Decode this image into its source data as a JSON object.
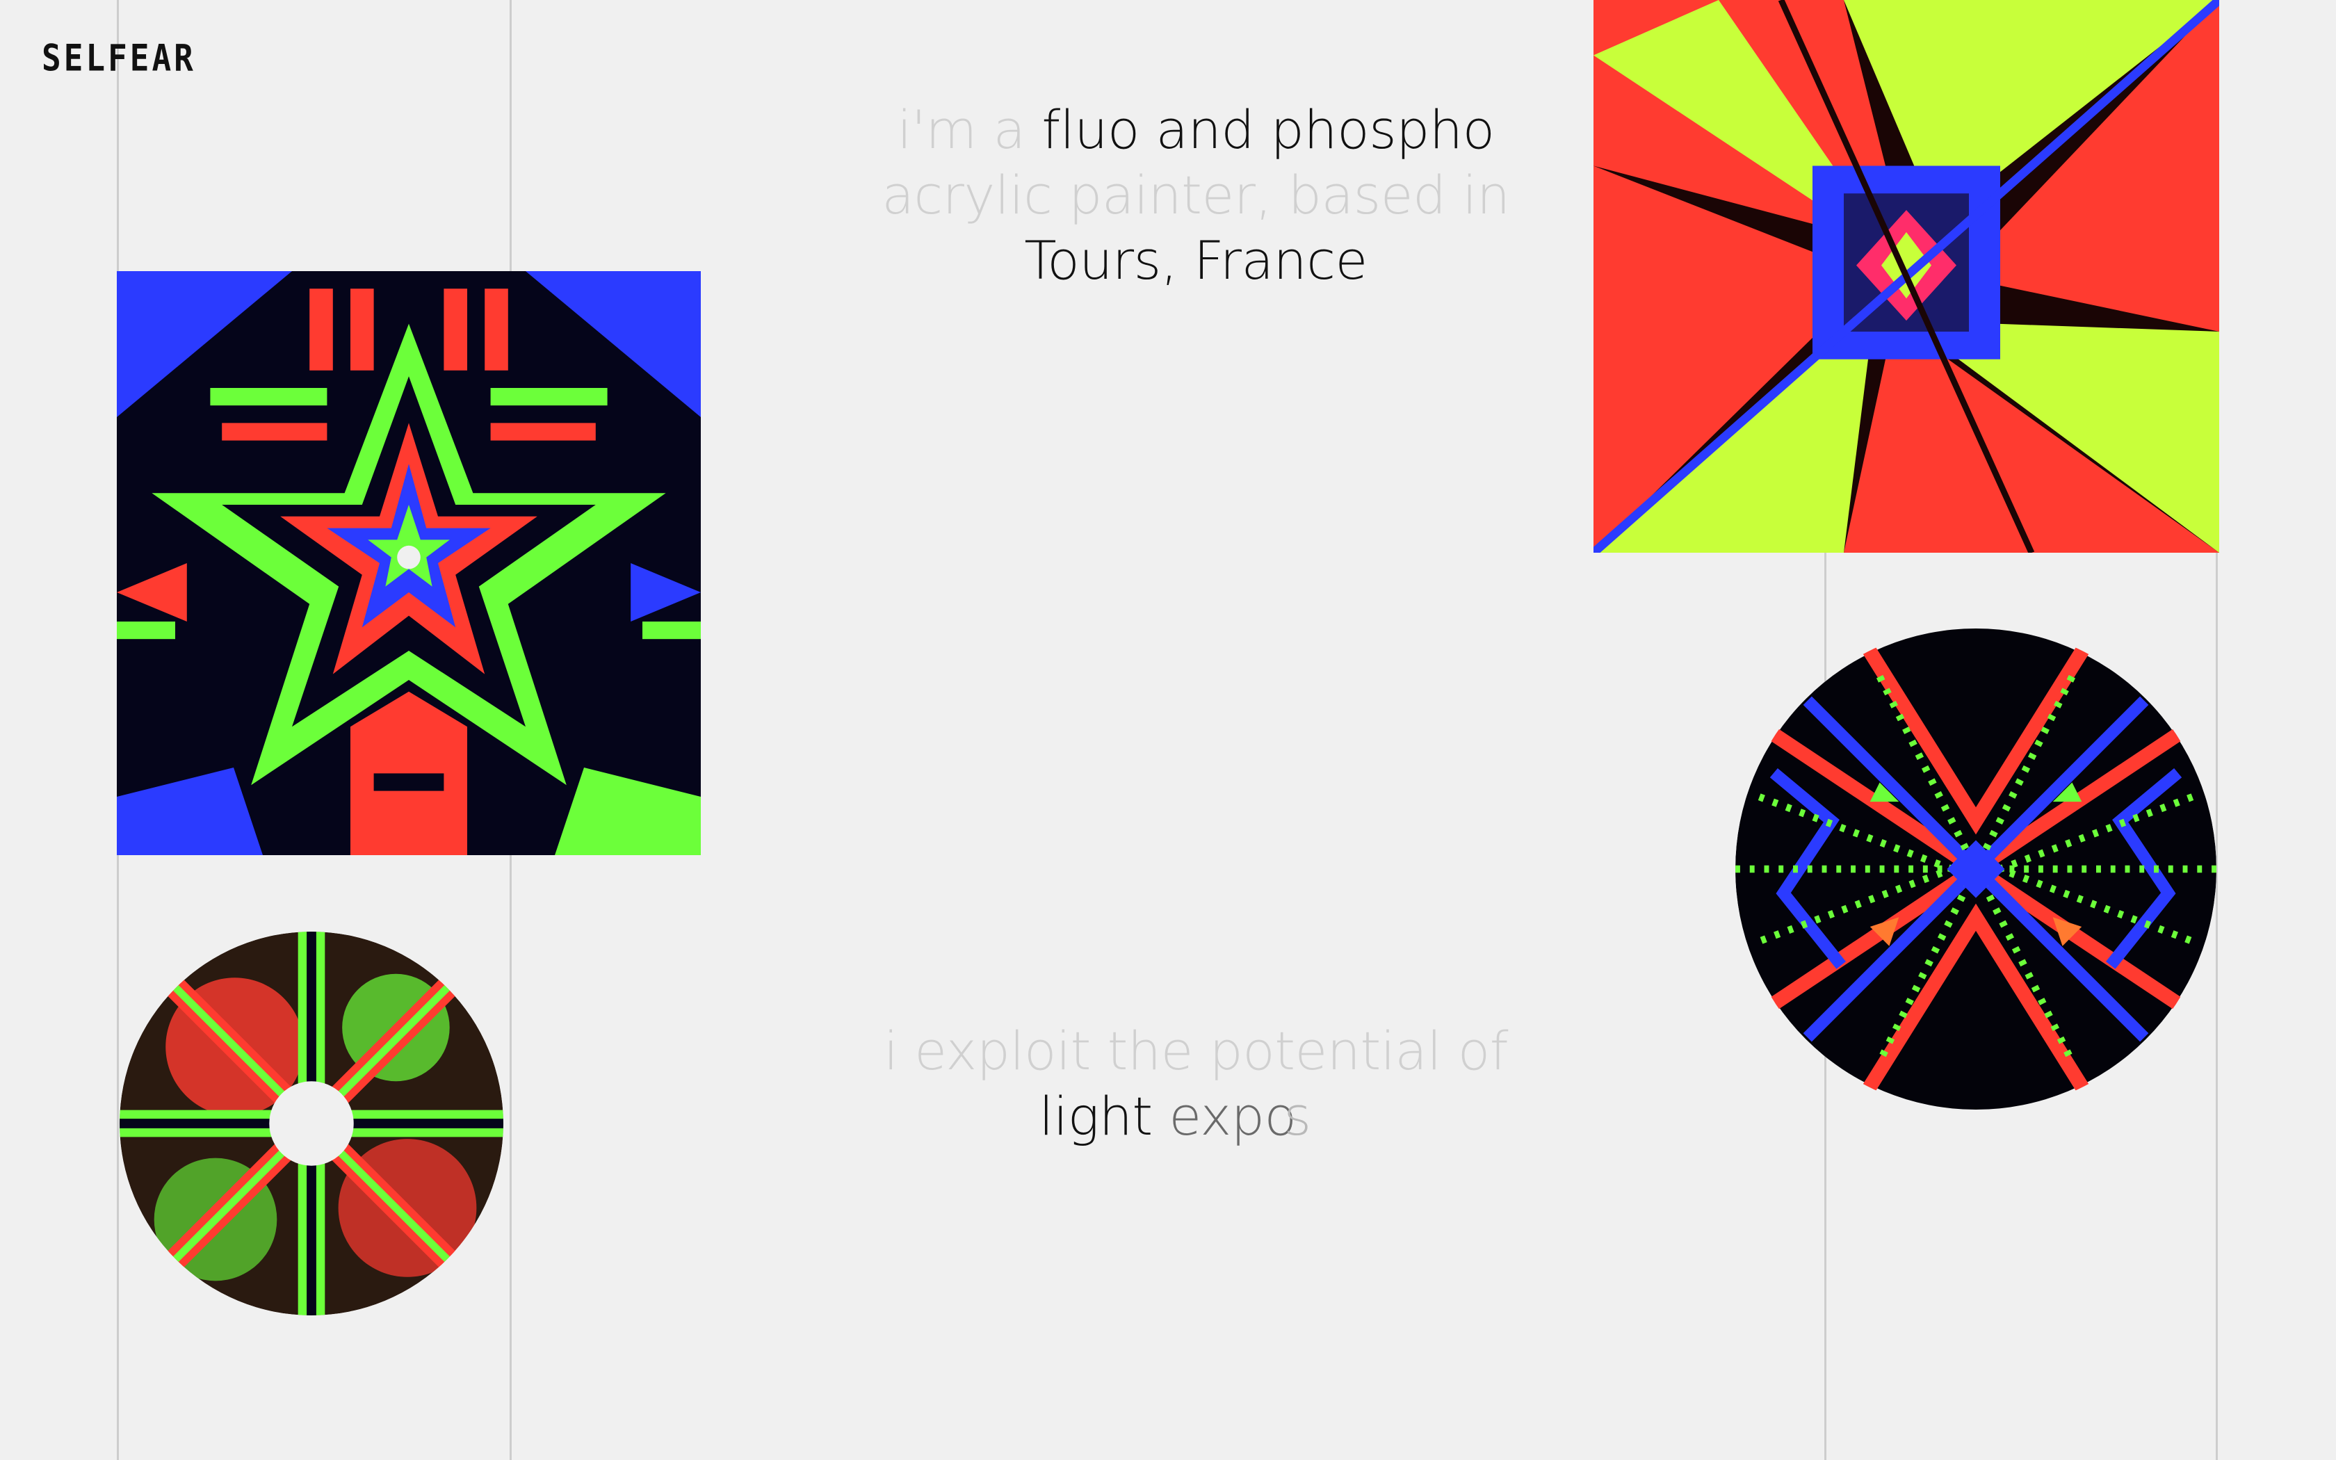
{
  "brand": {
    "logo": "SELFEAR"
  },
  "intro": {
    "line1_faint": "i'm a",
    "line1_dark": "fluo and phospho",
    "line2_faint": "acrylic painter, based in",
    "line3_dark": "Tours, France"
  },
  "statement": {
    "line1_faint": "i exploit the potential of",
    "line2_dark": "light",
    "line2_mid": "expo",
    "line2_faint": "s"
  },
  "artworks": [
    {
      "name": "fluo-star-painting"
    },
    {
      "name": "fluo-spiral-painting"
    },
    {
      "name": "fluo-disc-painting"
    },
    {
      "name": "fluo-x-mandala-painting"
    }
  ],
  "colors": {
    "background": "#f0f0f0",
    "neon_green": "#6cff3a",
    "neon_red": "#ff3b30",
    "neon_blue": "#2b3bff",
    "neon_yellow_green": "#c8ff3a",
    "dark": "#050510"
  }
}
